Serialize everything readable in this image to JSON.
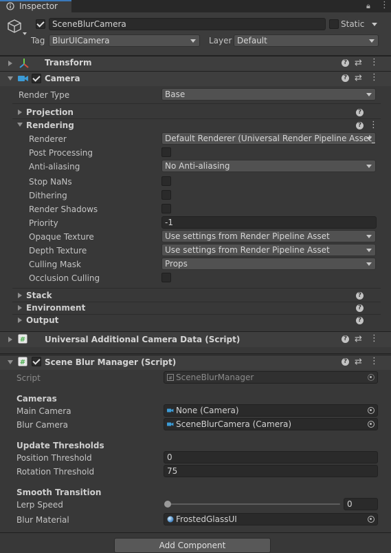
{
  "tab": {
    "title": "Inspector"
  },
  "gameobject": {
    "name": "SceneBlurCamera",
    "static_label": "Static",
    "tag_label": "Tag",
    "tag_value": "BlurUICamera",
    "layer_label": "Layer",
    "layer_value": "Default"
  },
  "transform": {
    "title": "Transform"
  },
  "camera": {
    "title": "Camera",
    "render_type_label": "Render Type",
    "render_type_value": "Base",
    "projection": "Projection",
    "rendering": "Rendering",
    "fields": {
      "renderer_label": "Renderer",
      "renderer_value": "Default Renderer (Universal Render Pipeline Asset_R",
      "post_processing_label": "Post Processing",
      "anti_aliasing_label": "Anti-aliasing",
      "anti_aliasing_value": "No Anti-aliasing",
      "stop_nans_label": "Stop NaNs",
      "dithering_label": "Dithering",
      "render_shadows_label": "Render Shadows",
      "priority_label": "Priority",
      "priority_value": "-1",
      "opaque_texture_label": "Opaque Texture",
      "opaque_texture_value": "Use settings from Render Pipeline Asset",
      "depth_texture_label": "Depth Texture",
      "depth_texture_value": "Use settings from Render Pipeline Asset",
      "culling_mask_label": "Culling Mask",
      "culling_mask_value": "Props",
      "occlusion_culling_label": "Occlusion Culling"
    },
    "stack": "Stack",
    "environment": "Environment",
    "output": "Output"
  },
  "uacd": {
    "title": "Universal Additional Camera Data (Script)"
  },
  "blur_manager": {
    "title": "Scene Blur Manager (Script)",
    "script_label": "Script",
    "script_value": "SceneBlurManager",
    "cameras_header": "Cameras",
    "main_camera_label": "Main Camera",
    "main_camera_value": "None (Camera)",
    "blur_camera_label": "Blur Camera",
    "blur_camera_value": "SceneBlurCamera (Camera)",
    "update_header": "Update Thresholds",
    "position_threshold_label": "Position Threshold",
    "position_threshold_value": "0",
    "rotation_threshold_label": "Rotation Threshold",
    "rotation_threshold_value": "75",
    "smooth_header": "Smooth Transition",
    "lerp_speed_label": "Lerp Speed",
    "lerp_speed_value": "0",
    "blur_material_label": "Blur Material",
    "blur_material_value": "FrostedGlassUI"
  },
  "add_component": "Add Component",
  "colors": {
    "accent": "#3a79bb",
    "camera_icon": "#3c9bd6",
    "script_icon": "#4caf50"
  }
}
